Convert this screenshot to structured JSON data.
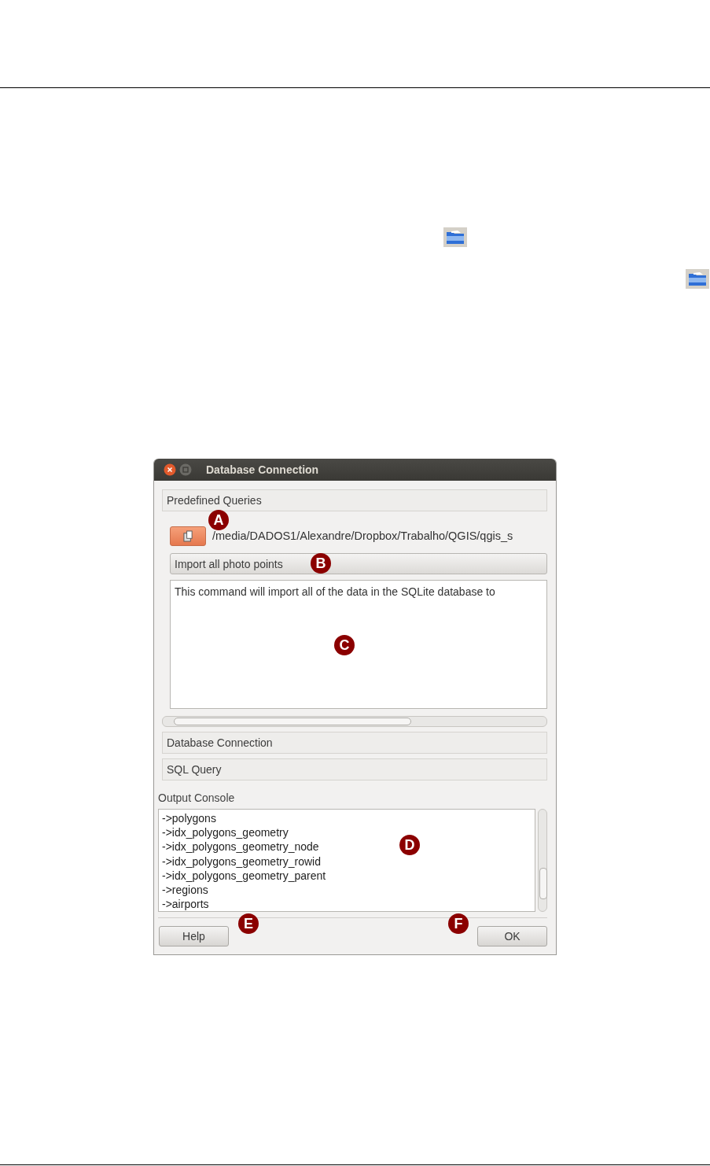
{
  "dialog": {
    "title": "Database Connection",
    "predefined_queries": {
      "header": "Predefined Queries",
      "path": "/media/DADOS1/Alexandre/Dropbox/Trabalho/QGIS/qgis_s",
      "query": "Import all photo points",
      "description": "This command will import all of the data in the SQLite database to"
    },
    "sections": [
      "Database Connection",
      "SQL Query"
    ],
    "output_console": {
      "label": "Output Console",
      "lines": [
        "->polygons",
        "->idx_polygons_geometry",
        "->idx_polygons_geometry_node",
        "->idx_polygons_geometry_rowid",
        "->idx_polygons_geometry_parent",
        "->regions",
        "->airports"
      ]
    },
    "buttons": {
      "help": "Help",
      "ok": "OK"
    }
  },
  "callouts": [
    "A",
    "B",
    "C",
    "D",
    "E",
    "F"
  ]
}
